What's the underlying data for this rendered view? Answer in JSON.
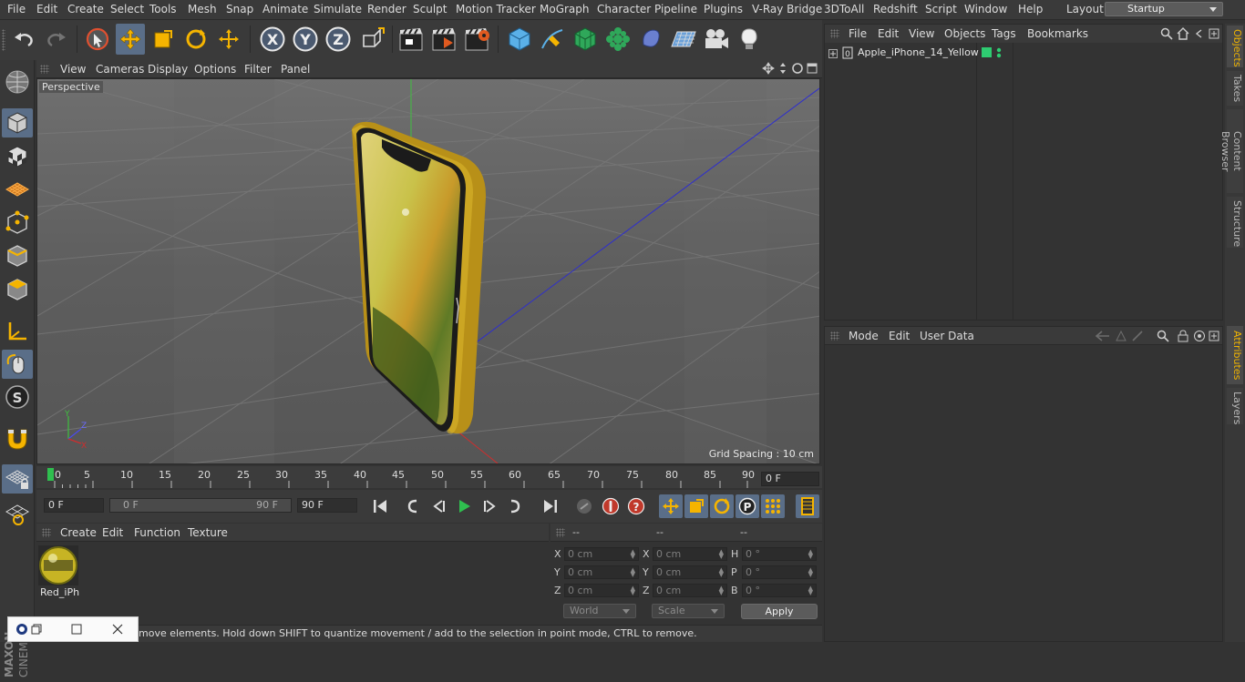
{
  "menubar": {
    "items": [
      "File",
      "Edit",
      "Create",
      "Select",
      "Tools",
      "Mesh",
      "Snap",
      "Animate",
      "Simulate",
      "Render",
      "Sculpt",
      "Motion Tracker",
      "MoGraph",
      "Character",
      "Pipeline",
      "Plugins",
      "V-Ray Bridge",
      "3DToAll",
      "Redshift",
      "Script",
      "Window",
      "Help"
    ],
    "layout_label": "Layout:",
    "layout_value": "Startup"
  },
  "toolbar": {
    "axis_x": "X",
    "axis_y": "Y",
    "axis_z": "Z"
  },
  "viewport": {
    "menu": [
      "View",
      "Cameras",
      "Display",
      "Options",
      "Filter",
      "Panel"
    ],
    "camera_label": "Perspective",
    "grid_spacing": "Grid Spacing : 10 cm",
    "axis_labels": {
      "x": "X",
      "y": "Y",
      "z": "Z"
    }
  },
  "timeline": {
    "ticks": [
      "0",
      "5",
      "10",
      "15",
      "20",
      "25",
      "30",
      "35",
      "40",
      "45",
      "50",
      "55",
      "60",
      "65",
      "70",
      "75",
      "80",
      "85",
      "90"
    ],
    "current_frame": "0 F"
  },
  "transport": {
    "start_frame": "0 F",
    "range_start": "0 F",
    "range_end": "90 F",
    "end_frame": "90 F"
  },
  "material_manager": {
    "menu": [
      "Create",
      "Edit",
      "Function",
      "Texture"
    ],
    "materials": [
      {
        "name": "Red_iPh"
      }
    ]
  },
  "coordinates": {
    "headers": [
      "--",
      "--",
      "--"
    ],
    "rows": [
      {
        "a": "X",
        "av": "0 cm",
        "b": "X",
        "bv": "0 cm",
        "c": "H",
        "cv": "0 °"
      },
      {
        "a": "Y",
        "av": "0 cm",
        "b": "Y",
        "bv": "0 cm",
        "c": "P",
        "cv": "0 °"
      },
      {
        "a": "Z",
        "av": "0 cm",
        "b": "Z",
        "bv": "0 cm",
        "c": "B",
        "cv": "0 °"
      }
    ],
    "mode_world": "World",
    "mode_scale": "Scale",
    "apply_label": "Apply"
  },
  "status": {
    "text": "move elements. Hold down SHIFT to quantize movement / add to the selection in point mode, CTRL to remove."
  },
  "object_manager": {
    "menu": [
      "File",
      "Edit",
      "View",
      "Objects",
      "Tags",
      "Bookmarks"
    ],
    "objects": [
      {
        "name": "Apple_iPhone_14_Yellow",
        "layer_color": "#2ecc71"
      }
    ]
  },
  "attribute_manager": {
    "menu": [
      "Mode",
      "Edit",
      "User Data"
    ]
  },
  "right_tabs": [
    "Objects",
    "Takes",
    "Content Browser",
    "Structure",
    "Attributes",
    "Layers"
  ],
  "brand": {
    "maxon": "MAXON",
    "product": "CINEMA 4D"
  },
  "colors": {
    "accent_blue": "#5a6e88",
    "active_tab": "#f0b400",
    "phone_frame": "#d9b52c"
  }
}
